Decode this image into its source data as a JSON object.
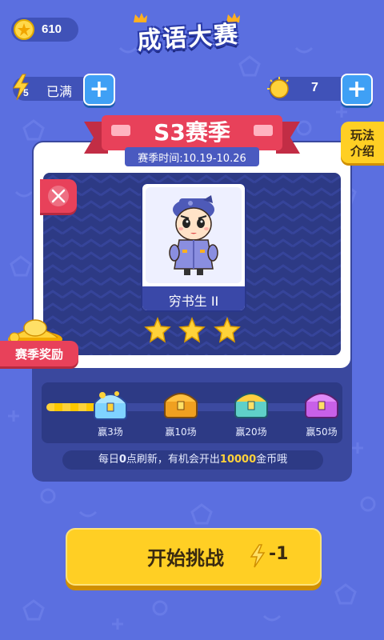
{
  "topbar": {
    "coins": "610",
    "title": "成语大赛"
  },
  "energy": {
    "count": "5",
    "status": "已满"
  },
  "hints": {
    "count": "7"
  },
  "season": {
    "name": "S3赛季",
    "time": "赛季时间:10.19-10.26",
    "rules_label": "玩法介绍",
    "rules_line1": "玩法",
    "rules_line2": "介绍",
    "reward_label": "赛季奖励"
  },
  "rank": {
    "title": "穷书生 II",
    "stars": 3
  },
  "progress": {
    "fill_fraction": 0.28,
    "chests": [
      {
        "label": "赢3场",
        "color": "blue"
      },
      {
        "label": "赢10场",
        "color": "gold"
      },
      {
        "label": "赢20场",
        "color": "teal"
      },
      {
        "label": "赢50场",
        "color": "purple"
      }
    ]
  },
  "notice": {
    "prefix": "每日",
    "zero": "0",
    "middle": "点刷新，有机会开出",
    "amount": "10000",
    "suffix": "金币哦"
  },
  "start": {
    "label": "开始挑战",
    "cost": "-1"
  },
  "colors": {
    "background": "#5b6fe0",
    "banner_red": "#e8415a",
    "button_yellow": "#ffcf24",
    "panel_dark": "#2d3a85"
  }
}
